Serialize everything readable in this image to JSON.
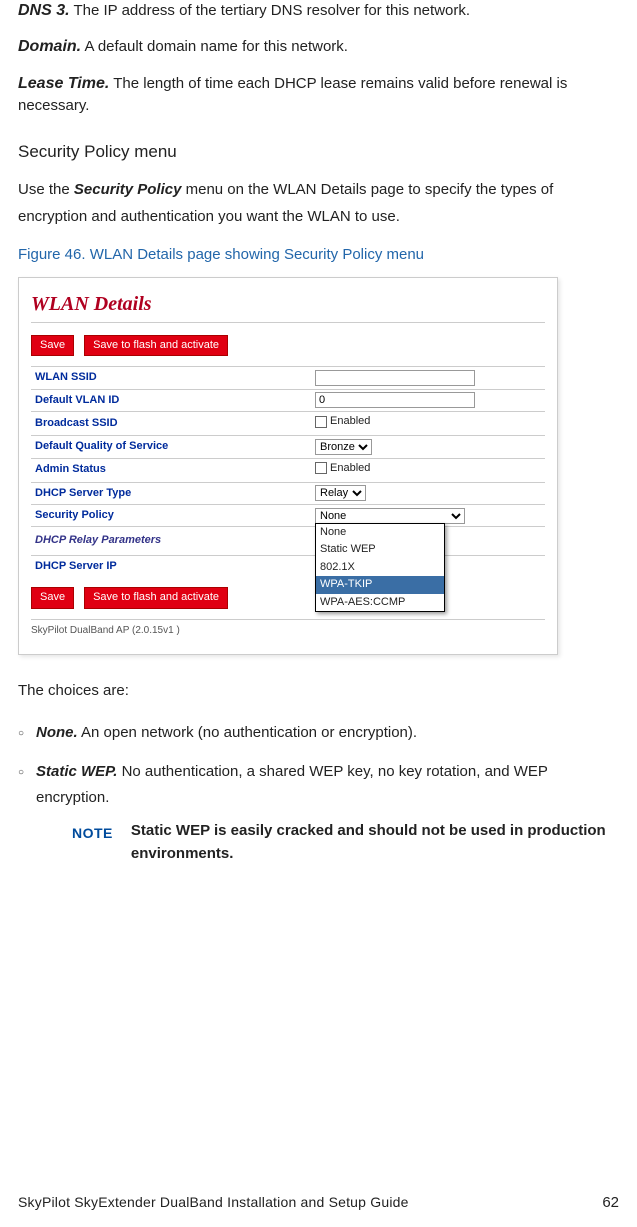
{
  "defs": [
    {
      "term": "DNS 3.",
      "text": "The IP address of the tertiary DNS resolver for this network."
    },
    {
      "term": "Domain.",
      "text": "A default domain name for this network."
    },
    {
      "term": "Lease Time.",
      "text": "The length of time each DHCP lease remains valid before renewal is necessary."
    }
  ],
  "section_heading": "Security Policy menu",
  "section_para_pre": "Use the ",
  "section_para_em": "Security Policy",
  "section_para_post": " menu on the WLAN Details page to specify the types of encryption and authentication you want the WLAN to use.",
  "figure_caption": "Figure 46. WLAN Details page showing Security Policy menu",
  "figure": {
    "title": "WLAN Details",
    "btn_save": "Save",
    "btn_save_flash": "Save to flash and activate",
    "rows": {
      "wlan_ssid_label": "WLAN SSID",
      "wlan_ssid_value": "",
      "default_vlan_label": "Default VLAN ID",
      "default_vlan_value": "0",
      "broadcast_ssid_label": "Broadcast SSID",
      "broadcast_ssid_enabled_text": "Enabled",
      "qos_label": "Default Quality of Service",
      "qos_value": "Bronze",
      "admin_status_label": "Admin Status",
      "admin_status_enabled_text": "Enabled",
      "dhcp_server_type_label": "DHCP Server Type",
      "dhcp_server_type_value": "Relay",
      "security_policy_label": "Security Policy",
      "security_policy_value": "None",
      "dhcp_relay_params_label": "DHCP Relay Parameters",
      "dhcp_server_ip_label": "DHCP Server IP",
      "dhcp_server_ip_value": ""
    },
    "dropdown": {
      "opt1": "None",
      "opt2": "Static WEP",
      "opt3": "802.1X",
      "opt4": "WPA-TKIP",
      "opt5": "WPA-AES:CCMP"
    },
    "footer_version": "SkyPilot DualBand AP (2.0.15v1 )"
  },
  "choices_intro": "The choices are:",
  "choices": [
    {
      "term": "None.",
      "text": "An open network (no authentication or encryption)."
    },
    {
      "term": "Static WEP.",
      "text": "No authentication, a shared WEP key, no key rotation, and WEP encryption."
    }
  ],
  "note": {
    "label": "NOTE",
    "text": "Static WEP is easily cracked and should not be used in production environments."
  },
  "footer": {
    "title": "SkyPilot SkyExtender DualBand Installation and Setup Guide",
    "page": "62"
  }
}
